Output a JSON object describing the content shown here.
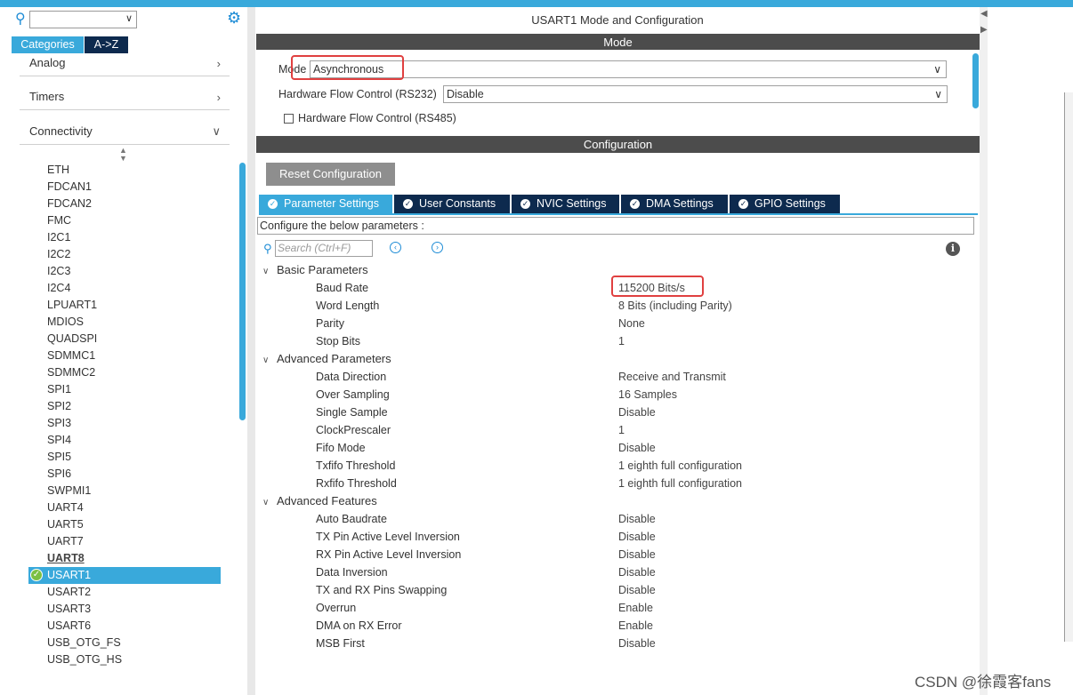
{
  "left_panel": {
    "search_value": "",
    "tabs": [
      "Categories",
      "A->Z"
    ],
    "groups": [
      "Analog",
      "Timers",
      "Connectivity"
    ],
    "peripherals": [
      "ETH",
      "FDCAN1",
      "FDCAN2",
      "FMC",
      "I2C1",
      "I2C2",
      "I2C3",
      "I2C4",
      "LPUART1",
      "MDIOS",
      "QUADSPI",
      "SDMMC1",
      "SDMMC2",
      "SPI1",
      "SPI2",
      "SPI3",
      "SPI4",
      "SPI5",
      "SPI6",
      "SWPMI1",
      "UART4",
      "UART5",
      "UART7",
      "UART8",
      "USART1",
      "USART2",
      "USART3",
      "USART6",
      "USB_OTG_FS",
      "USB_OTG_HS"
    ],
    "selected": "USART1"
  },
  "main": {
    "title": "USART1 Mode and Configuration",
    "mode_header": "Mode",
    "mode_label": "Mode",
    "mode_value": "Asynchronous",
    "hw_flow_232_label": "Hardware Flow Control (RS232)",
    "hw_flow_232_value": "Disable",
    "hw_flow_485_label": "Hardware Flow Control (RS485)",
    "hw_flow_485_checked": false,
    "config_header": "Configuration",
    "reset_button": "Reset Configuration",
    "tabs": [
      "Parameter Settings",
      "User Constants",
      "NVIC Settings",
      "DMA Settings",
      "GPIO Settings"
    ],
    "active_tab": "Parameter Settings",
    "configure_text": "Configure the below parameters :",
    "search_placeholder": "Search (Ctrl+F)",
    "sections": [
      {
        "title": "Basic Parameters",
        "params": [
          {
            "name": "Baud Rate",
            "value": "115200 Bits/s"
          },
          {
            "name": "Word Length",
            "value": "8 Bits (including Parity)"
          },
          {
            "name": "Parity",
            "value": "None"
          },
          {
            "name": "Stop Bits",
            "value": "1"
          }
        ]
      },
      {
        "title": "Advanced Parameters",
        "params": [
          {
            "name": "Data Direction",
            "value": "Receive and Transmit"
          },
          {
            "name": "Over Sampling",
            "value": "16 Samples"
          },
          {
            "name": "Single Sample",
            "value": "Disable"
          },
          {
            "name": "ClockPrescaler",
            "value": "1"
          },
          {
            "name": "Fifo Mode",
            "value": "Disable"
          },
          {
            "name": "Txfifo Threshold",
            "value": "1 eighth full configuration"
          },
          {
            "name": "Rxfifo Threshold",
            "value": "1 eighth full configuration"
          }
        ]
      },
      {
        "title": "Advanced Features",
        "params": [
          {
            "name": "Auto Baudrate",
            "value": "Disable"
          },
          {
            "name": "TX Pin Active Level Inversion",
            "value": "Disable"
          },
          {
            "name": "RX Pin Active Level Inversion",
            "value": "Disable"
          },
          {
            "name": "Data Inversion",
            "value": "Disable"
          },
          {
            "name": "TX and RX Pins Swapping",
            "value": "Disable"
          },
          {
            "name": "Overrun",
            "value": "Enable"
          },
          {
            "name": "DMA on RX Error",
            "value": "Enable"
          },
          {
            "name": "MSB First",
            "value": "Disable"
          }
        ]
      }
    ]
  },
  "watermark": "CSDN @徐霞客fans",
  "colors": {
    "accent": "#39a9db",
    "dark_tab": "#0d2a4e",
    "header_bar": "#4c4c4c",
    "highlight": "#e04040"
  }
}
